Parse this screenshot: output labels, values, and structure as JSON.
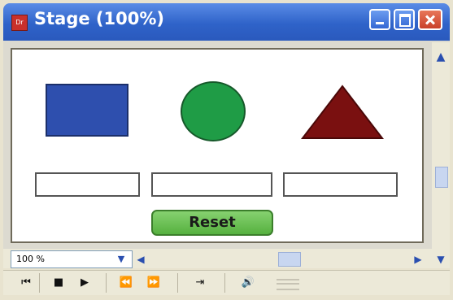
{
  "window": {
    "title": "Stage (100%)",
    "app_icon_text": "Dr"
  },
  "stage": {
    "shapes": [
      {
        "kind": "rectangle",
        "color": "#2e4fae"
      },
      {
        "kind": "circle",
        "color": "#1f9c46"
      },
      {
        "kind": "triangle",
        "color": "#7a1010"
      }
    ],
    "fields": [
      "",
      "",
      ""
    ],
    "reset_label": "Reset"
  },
  "bottom_bar": {
    "zoom_value": "100 %"
  },
  "controller": {
    "buttons": [
      "rewind",
      "stop",
      "play",
      "step-back",
      "step-forward",
      "loop",
      "volume"
    ]
  }
}
